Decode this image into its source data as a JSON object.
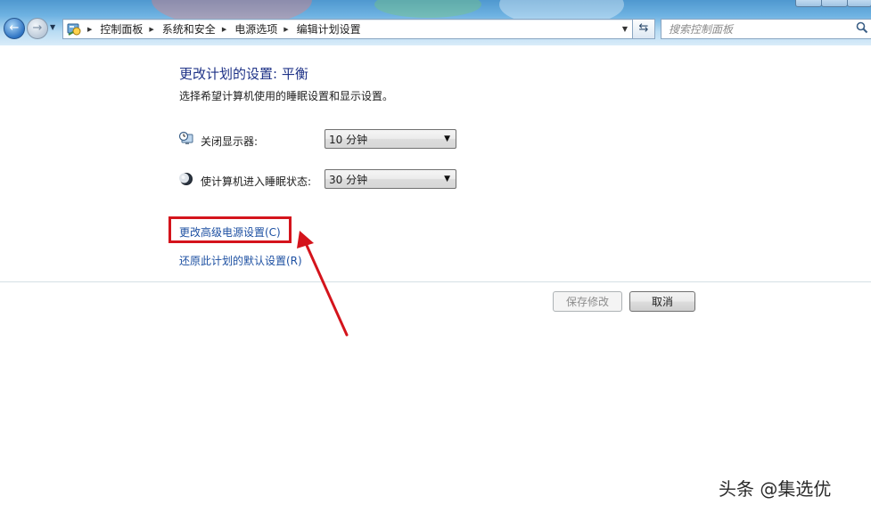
{
  "nav": {
    "back_glyph": "←",
    "forward_glyph": "→"
  },
  "breadcrumb": {
    "items": [
      "控制面板",
      "系统和安全",
      "电源选项",
      "编辑计划设置"
    ]
  },
  "search": {
    "placeholder": "搜索控制面板"
  },
  "page": {
    "title": "更改计划的设置: 平衡",
    "subtitle": "选择希望计算机使用的睡眠设置和显示设置。"
  },
  "settings": {
    "display_off_label": "关闭显示器:",
    "display_off_value": "10 分钟",
    "sleep_label": "使计算机进入睡眠状态:",
    "sleep_value": "30 分钟"
  },
  "links": {
    "advanced": "更改高级电源设置(C)",
    "restore_defaults": "还原此计划的默认设置(R)"
  },
  "buttons": {
    "save": "保存修改",
    "cancel": "取消"
  },
  "annotation": {
    "color": "#d4141c"
  },
  "watermark": {
    "text": "头条 @集选优"
  },
  "icons": [
    "back-arrow-icon",
    "forward-arrow-icon",
    "control-panel-icon",
    "refresh-icon",
    "search-icon",
    "monitor-clock-icon",
    "moon-icon"
  ]
}
